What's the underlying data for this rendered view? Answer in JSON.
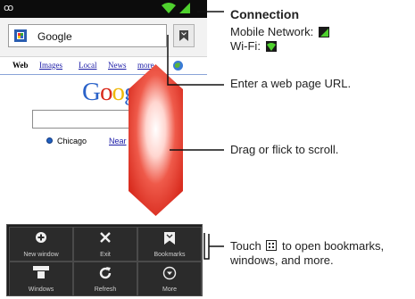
{
  "status_bar": {
    "voicemail_icon": "voicemail-icon",
    "wifi_icon": "wifi-icon",
    "signal_icon": "signal-icon"
  },
  "browser": {
    "url_value": "Google",
    "bookmark_button_icon": "bookmark-icon",
    "nav_links": [
      "Web",
      "Images",
      "Local",
      "News",
      "more"
    ],
    "logo_text": "Goog",
    "search_query": "",
    "location_text": "Chicago",
    "nearby_text": "Near"
  },
  "menu": {
    "items": [
      {
        "label": "New window",
        "icon": "plus-icon"
      },
      {
        "label": "Exit",
        "icon": "close-icon"
      },
      {
        "label": "Bookmarks",
        "icon": "bookmark-icon"
      },
      {
        "label": "Windows",
        "icon": "windows-icon"
      },
      {
        "label": "Refresh",
        "icon": "refresh-icon"
      },
      {
        "label": "More",
        "icon": "more-icon"
      }
    ]
  },
  "callouts": {
    "connection_title": "Connection",
    "mobile_network_label": "Mobile Network:",
    "wifi_label": "Wi-Fi:",
    "url_callout": "Enter a web page URL.",
    "scroll_callout": "Drag or flick to scroll.",
    "touch_prefix": "Touch",
    "touch_suffix": "to open bookmarks,",
    "touch_line2": "windows, and more."
  },
  "colors": {
    "callout_line": "#111111",
    "signal_green": "#3aa52a",
    "arrow_red": "#e8392c",
    "link_blue": "#1a1aa6"
  }
}
